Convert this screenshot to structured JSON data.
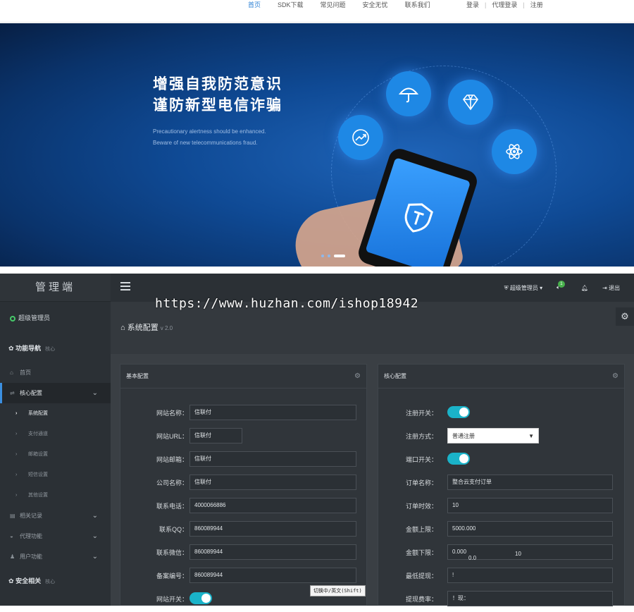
{
  "site": {
    "nav": [
      "首页",
      "SDK下载",
      "常见问题",
      "安全无忧",
      "联系我们"
    ],
    "nav_active": 0,
    "auth": [
      "登录",
      "代理登录",
      "注册"
    ],
    "banner_title": [
      "增强自我防范意识",
      "谨防新型电信诈骗"
    ],
    "banner_sub": [
      "Precautionary alertness should be enhanced.",
      "Beware of new telecommunications fraud."
    ],
    "slides": 3,
    "active_slide": 2
  },
  "watermark": "https://www.huzhan.com/ishop18942",
  "admin": {
    "brand": "管理端",
    "user": "超级管理员",
    "section_title": "功能导航",
    "section_sub": "核心",
    "menu": {
      "home": "首页",
      "core": "核心配置",
      "sub": [
        "系统配置",
        "支付通道",
        "邮箱设置",
        "短信设置",
        "其他设置"
      ],
      "records": "相关记录",
      "agent": "代理功能",
      "users": "用户功能"
    },
    "security_title": "安全相关",
    "security_sub": "核心",
    "topbar": {
      "role": "超级管理员",
      "msg_count": "1",
      "logout": "退出"
    },
    "page_title": "系统配置",
    "version": "v 2.0",
    "basic": {
      "title": "基本配置",
      "fields": [
        {
          "label": "网站名称：",
          "value": "信联付"
        },
        {
          "label": "网站URL：",
          "value": "信联付"
        },
        {
          "label": "网站邮箱：",
          "value": "信联付"
        },
        {
          "label": "公司名称：",
          "value": "信联付"
        },
        {
          "label": "联系电话：",
          "value": "4000066886"
        },
        {
          "label": "联系QQ：",
          "value": "860089944"
        },
        {
          "label": "联系微信：",
          "value": "860089944"
        },
        {
          "label": "备案编号：",
          "value": "860089944"
        }
      ],
      "switch_label": "网站开关："
    },
    "core": {
      "title": "核心配置",
      "register_switch": "注册开关：",
      "register_mode_label": "注册方式：",
      "register_mode_value": "普通注册",
      "port_switch": "端口开关：",
      "fields": [
        {
          "label": "订单名称：",
          "value": "整合云支付订单"
        },
        {
          "label": "订单时效：",
          "value": "10"
        },
        {
          "label": "金额上限：",
          "value": "5000.000"
        },
        {
          "label": "金额下限：",
          "value": "0.000"
        },
        {
          "label": "最低提现：",
          "value": "!"
        },
        {
          "label": "提现费率：",
          "value": "！现："
        }
      ],
      "overlay_values": [
        "0.0",
        "10"
      ]
    },
    "ime_tip": "切换中/英文(Shift)"
  }
}
